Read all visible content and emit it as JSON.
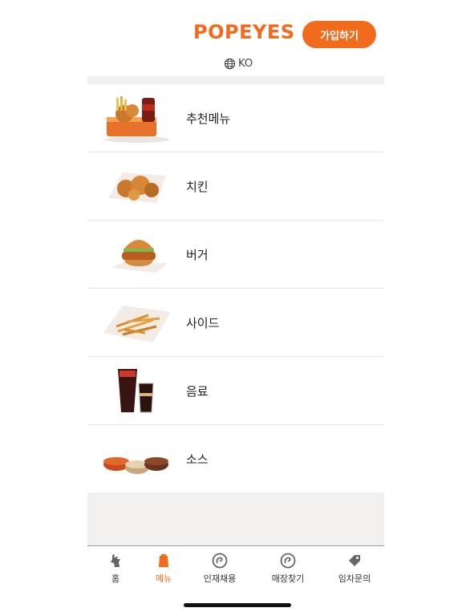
{
  "header": {
    "logo_text": "POPEYES",
    "join_label": "가입하기",
    "language": "KO",
    "brand_color": "#f26a1b"
  },
  "menu": {
    "items": [
      {
        "label": "추천메뉴",
        "icon": "combo-meal-image"
      },
      {
        "label": "치킨",
        "icon": "chicken-image"
      },
      {
        "label": "버거",
        "icon": "burger-image"
      },
      {
        "label": "사이드",
        "icon": "fries-image"
      },
      {
        "label": "음료",
        "icon": "drinks-image"
      },
      {
        "label": "소스",
        "icon": "sauces-image"
      }
    ]
  },
  "nav": {
    "items": [
      {
        "label": "홈",
        "icon": "chicken-logo-icon"
      },
      {
        "label": "메뉴",
        "icon": "menu-bag-icon",
        "active": true
      },
      {
        "label": "인재채용",
        "icon": "careers-icon"
      },
      {
        "label": "매장찾기",
        "icon": "store-locator-icon"
      },
      {
        "label": "임차문의",
        "icon": "tag-icon"
      }
    ]
  }
}
